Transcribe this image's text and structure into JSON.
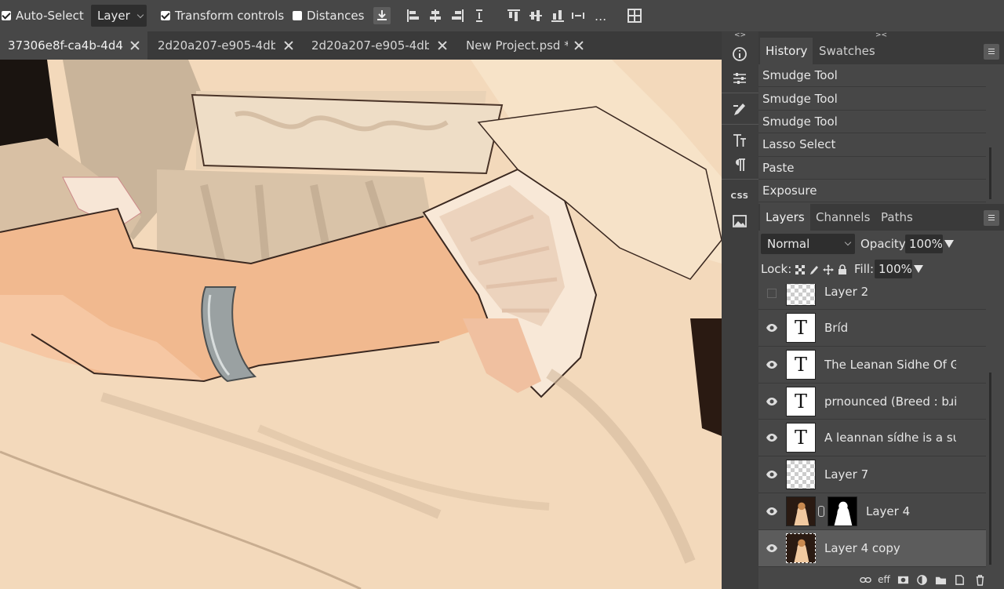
{
  "options_bar": {
    "auto_select_label": "Auto-Select",
    "auto_select_checked": true,
    "target_select": "Layer",
    "transform_controls_label": "Transform controls",
    "transform_controls_checked": true,
    "distances_label": "Distances",
    "distances_checked": false,
    "more_label": "..."
  },
  "tabs": [
    {
      "label": "37306e8f-ca4b-4d4",
      "modified": "*",
      "active": true
    },
    {
      "label": "2d20a207-e905-4db",
      "modified": "*",
      "active": false
    },
    {
      "label": "2d20a207-e905-4db",
      "modified": "*",
      "active": false
    },
    {
      "label": "New Project.psd",
      "modified": "*",
      "active": false
    }
  ],
  "side_strip": {
    "collapse_left": "<>",
    "css_label": "CSS"
  },
  "history_panel": {
    "collapse_label": "><",
    "tabs": [
      "History",
      "Swatches"
    ],
    "items": [
      "Smudge Tool",
      "Smudge Tool",
      "Smudge Tool",
      "Lasso Select",
      "Paste",
      "Exposure"
    ]
  },
  "layers_panel": {
    "tabs": [
      "Layers",
      "Channels",
      "Paths"
    ],
    "blend_mode": "Normal",
    "opacity_label": "Opacity:",
    "opacity_value": "100%",
    "lock_label": "Lock:",
    "fill_label": "Fill:",
    "fill_value": "100%",
    "layers": [
      {
        "name": "Layer 2",
        "type": "pixel-empty",
        "visible": false
      },
      {
        "name": "Bríd",
        "type": "text",
        "visible": true
      },
      {
        "name": "The Leanan Sidhe Of Galway",
        "type": "text",
        "visible": true
      },
      {
        "name": "prnounced (Breed : bɹid)",
        "type": "text",
        "visible": true
      },
      {
        "name": "A leannan sídhe is a supernatural",
        "type": "text",
        "visible": true
      },
      {
        "name": "Layer 7",
        "type": "pixel-empty",
        "visible": true
      },
      {
        "name": "Layer 4",
        "type": "photo-mask",
        "visible": true
      },
      {
        "name": "Layer 4 copy",
        "type": "photo",
        "visible": true,
        "selected": true
      }
    ],
    "text_thumb_glyph": "T",
    "effects_label": "eff"
  },
  "colors": {
    "app_bg": "#474747",
    "tab_bg": "#3a3a3a",
    "input_bg": "#2e2e2e",
    "selected_layer": "#5c5c5c"
  }
}
